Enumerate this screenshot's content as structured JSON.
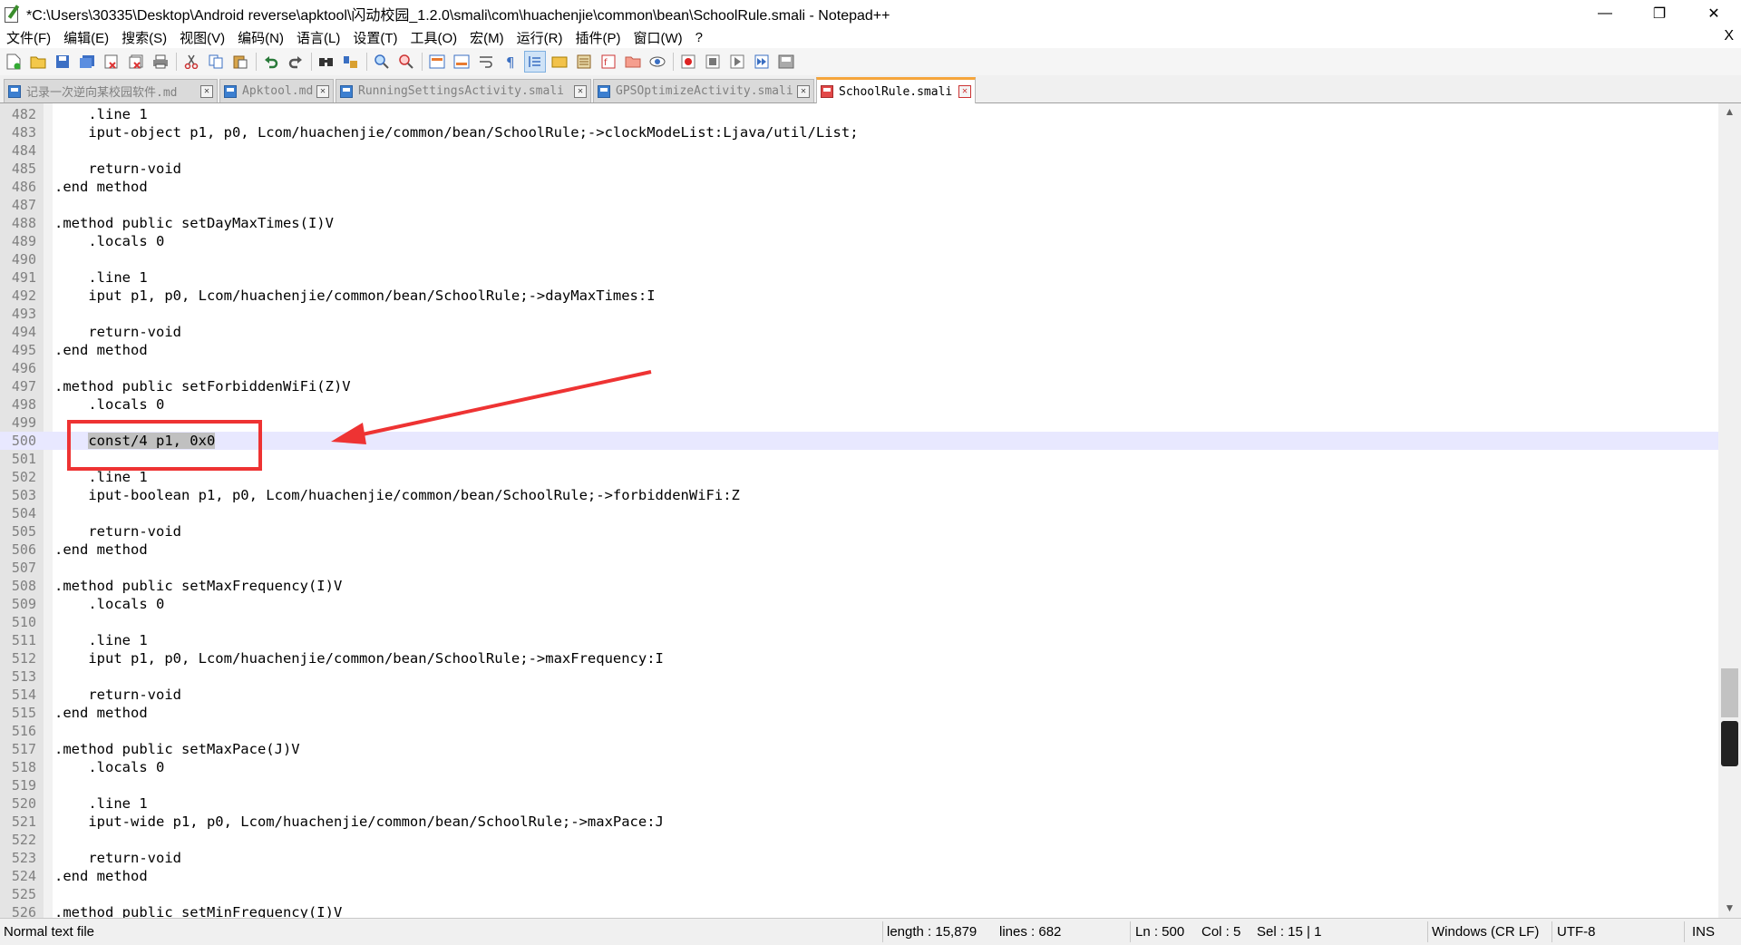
{
  "window": {
    "title": "*C:\\Users\\30335\\Desktop\\Android reverse\\apktool\\闪动校园_1.2.0\\smali\\com\\huachenjie\\common\\bean\\SchoolRule.smali - Notepad++",
    "minimize": "—",
    "maximize": "❐",
    "close": "✕"
  },
  "menu": {
    "items": [
      "文件(F)",
      "编辑(E)",
      "搜索(S)",
      "视图(V)",
      "编码(N)",
      "语言(L)",
      "设置(T)",
      "工具(O)",
      "宏(M)",
      "运行(R)",
      "插件(P)",
      "窗口(W)",
      "?"
    ],
    "close": "X"
  },
  "toolbar": {
    "buttons": [
      "new-file",
      "open-file",
      "save",
      "save-all",
      "close",
      "close-all",
      "print",
      "cut",
      "copy",
      "paste",
      "undo",
      "redo",
      "find",
      "replace",
      "zoom-in",
      "zoom-out",
      "sync-vertical",
      "sync-horizontal",
      "word-wrap",
      "show-all-chars",
      "indent-guide",
      "define-language",
      "document-map",
      "function-list",
      "folder-as-workspace",
      "monitoring",
      "record-macro",
      "stop-record",
      "play-macro",
      "run-macro-multiple",
      "save-macro"
    ]
  },
  "tabs": [
    {
      "label": "记录一次逆向某校园软件.md",
      "state": "saved",
      "active": false
    },
    {
      "label": "Apktool.md",
      "state": "saved",
      "active": false
    },
    {
      "label": "RunningSettingsActivity.smali",
      "state": "saved",
      "active": false
    },
    {
      "label": "GPSOptimizeActivity.smali",
      "state": "saved",
      "active": false
    },
    {
      "label": "SchoolRule.smali",
      "state": "unsaved",
      "active": true
    }
  ],
  "editor": {
    "lines": [
      {
        "n": "482",
        "code": "    .line 1"
      },
      {
        "n": "483",
        "code": "    iput-object p1, p0, Lcom/huachenjie/common/bean/SchoolRule;->clockModeList:Ljava/util/List;"
      },
      {
        "n": "484",
        "code": ""
      },
      {
        "n": "485",
        "code": "    return-void"
      },
      {
        "n": "486",
        "code": ".end method"
      },
      {
        "n": "487",
        "code": ""
      },
      {
        "n": "488",
        "code": ".method public setDayMaxTimes(I)V"
      },
      {
        "n": "489",
        "code": "    .locals 0"
      },
      {
        "n": "490",
        "code": ""
      },
      {
        "n": "491",
        "code": "    .line 1"
      },
      {
        "n": "492",
        "code": "    iput p1, p0, Lcom/huachenjie/common/bean/SchoolRule;->dayMaxTimes:I"
      },
      {
        "n": "493",
        "code": ""
      },
      {
        "n": "494",
        "code": "    return-void"
      },
      {
        "n": "495",
        "code": ".end method"
      },
      {
        "n": "496",
        "code": ""
      },
      {
        "n": "497",
        "code": ".method public setForbiddenWiFi(Z)V"
      },
      {
        "n": "498",
        "code": "    .locals 0"
      },
      {
        "n": "499",
        "code": ""
      },
      {
        "n": "500",
        "code": "    ",
        "selected": "const/4 p1, 0x0",
        "current": true
      },
      {
        "n": "501",
        "code": ""
      },
      {
        "n": "502",
        "code": "    .line 1"
      },
      {
        "n": "503",
        "code": "    iput-boolean p1, p0, Lcom/huachenjie/common/bean/SchoolRule;->forbiddenWiFi:Z"
      },
      {
        "n": "504",
        "code": ""
      },
      {
        "n": "505",
        "code": "    return-void"
      },
      {
        "n": "506",
        "code": ".end method"
      },
      {
        "n": "507",
        "code": ""
      },
      {
        "n": "508",
        "code": ".method public setMaxFrequency(I)V"
      },
      {
        "n": "509",
        "code": "    .locals 0"
      },
      {
        "n": "510",
        "code": ""
      },
      {
        "n": "511",
        "code": "    .line 1"
      },
      {
        "n": "512",
        "code": "    iput p1, p0, Lcom/huachenjie/common/bean/SchoolRule;->maxFrequency:I"
      },
      {
        "n": "513",
        "code": ""
      },
      {
        "n": "514",
        "code": "    return-void"
      },
      {
        "n": "515",
        "code": ".end method"
      },
      {
        "n": "516",
        "code": ""
      },
      {
        "n": "517",
        "code": ".method public setMaxPace(J)V"
      },
      {
        "n": "518",
        "code": "    .locals 0"
      },
      {
        "n": "519",
        "code": ""
      },
      {
        "n": "520",
        "code": "    .line 1"
      },
      {
        "n": "521",
        "code": "    iput-wide p1, p0, Lcom/huachenjie/common/bean/SchoolRule;->maxPace:J"
      },
      {
        "n": "522",
        "code": ""
      },
      {
        "n": "523",
        "code": "    return-void"
      },
      {
        "n": "524",
        "code": ".end method"
      },
      {
        "n": "525",
        "code": ""
      },
      {
        "n": "526",
        "code": ".method public setMinFrequency(I)V"
      }
    ]
  },
  "scrollbar": {
    "up": "▲",
    "down": "▼"
  },
  "status": {
    "file_type": "Normal text file",
    "length": "length : 15,879",
    "lines": "lines : 682",
    "ln": "Ln : 500",
    "col": "Col : 5",
    "sel": "Sel : 15 | 1",
    "eol": "Windows (CR LF)",
    "encoding": "UTF-8",
    "mode": "INS"
  },
  "colors": {
    "annotation": "#ee3333",
    "current_line": "#e8e8ff",
    "active_tab_accent": "#f5a53b"
  }
}
